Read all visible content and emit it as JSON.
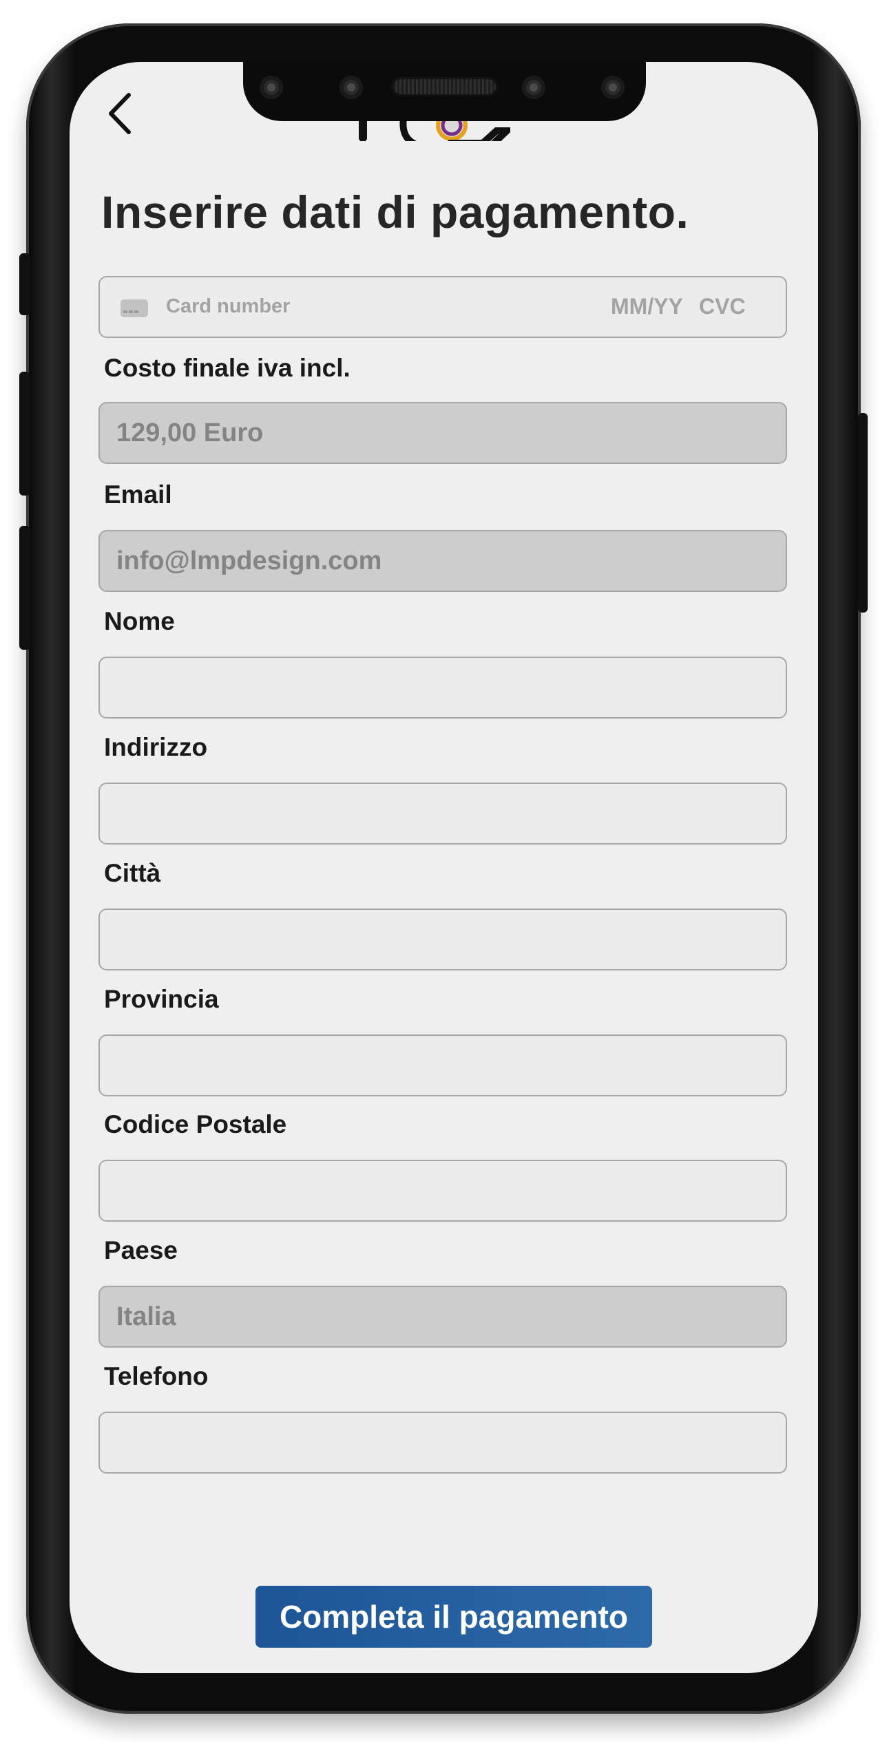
{
  "header": {
    "title": "Inserire dati di pagamento.",
    "back_icon": "chevron-left-icon"
  },
  "card": {
    "icon": "credit-card-icon",
    "number_placeholder": "Card number",
    "expiry_placeholder": "MM/YY",
    "cvc_placeholder": "CVC"
  },
  "form": {
    "price": {
      "label": "Costo finale iva incl.",
      "value": "129,00 Euro"
    },
    "email": {
      "label": "Email",
      "value": "info@lmpdesign.com"
    },
    "name": {
      "label": "Nome",
      "value": ""
    },
    "address": {
      "label": "Indirizzo",
      "value": ""
    },
    "city": {
      "label": "Città",
      "value": ""
    },
    "province": {
      "label": "Provincia",
      "value": ""
    },
    "postal_code": {
      "label": "Codice Postale",
      "value": ""
    },
    "country": {
      "label": "Paese",
      "value": "Italia"
    },
    "phone": {
      "label": "Telefono",
      "value": ""
    }
  },
  "actions": {
    "submit_label": "Completa il pagamento"
  },
  "colors": {
    "screen_background": "#efefef",
    "disabled_field": "#cdcdcd",
    "button_primary": "#1d5596",
    "text_dark": "#1a1a1a"
  }
}
